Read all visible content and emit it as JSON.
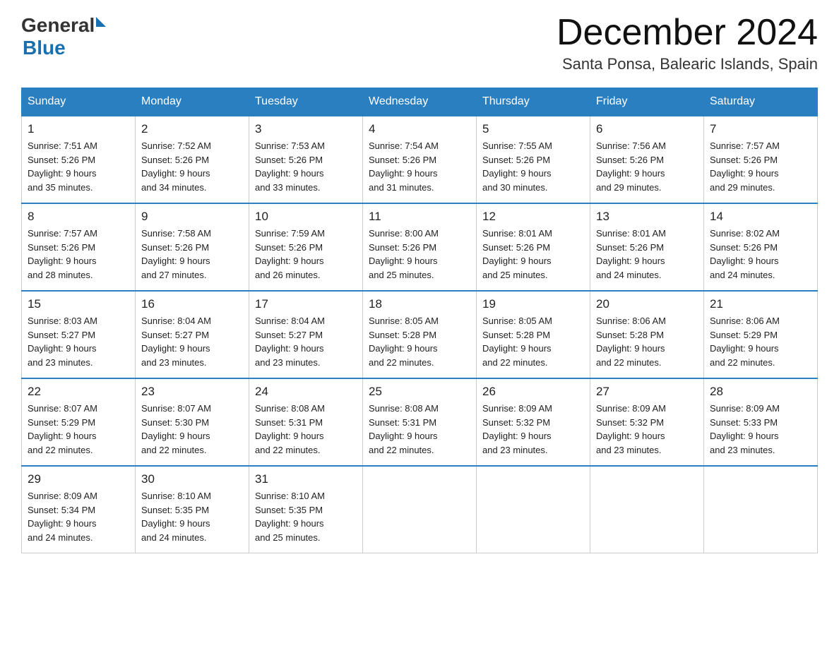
{
  "header": {
    "logo": {
      "general": "General",
      "blue": "Blue",
      "triangle": "▶"
    },
    "month_title": "December 2024",
    "location": "Santa Ponsa, Balearic Islands, Spain"
  },
  "calendar": {
    "days_of_week": [
      "Sunday",
      "Monday",
      "Tuesday",
      "Wednesday",
      "Thursday",
      "Friday",
      "Saturday"
    ],
    "weeks": [
      [
        {
          "day": "1",
          "sunrise": "7:51 AM",
          "sunset": "5:26 PM",
          "daylight": "9 hours and 35 minutes."
        },
        {
          "day": "2",
          "sunrise": "7:52 AM",
          "sunset": "5:26 PM",
          "daylight": "9 hours and 34 minutes."
        },
        {
          "day": "3",
          "sunrise": "7:53 AM",
          "sunset": "5:26 PM",
          "daylight": "9 hours and 33 minutes."
        },
        {
          "day": "4",
          "sunrise": "7:54 AM",
          "sunset": "5:26 PM",
          "daylight": "9 hours and 31 minutes."
        },
        {
          "day": "5",
          "sunrise": "7:55 AM",
          "sunset": "5:26 PM",
          "daylight": "9 hours and 30 minutes."
        },
        {
          "day": "6",
          "sunrise": "7:56 AM",
          "sunset": "5:26 PM",
          "daylight": "9 hours and 29 minutes."
        },
        {
          "day": "7",
          "sunrise": "7:57 AM",
          "sunset": "5:26 PM",
          "daylight": "9 hours and 29 minutes."
        }
      ],
      [
        {
          "day": "8",
          "sunrise": "7:57 AM",
          "sunset": "5:26 PM",
          "daylight": "9 hours and 28 minutes."
        },
        {
          "day": "9",
          "sunrise": "7:58 AM",
          "sunset": "5:26 PM",
          "daylight": "9 hours and 27 minutes."
        },
        {
          "day": "10",
          "sunrise": "7:59 AM",
          "sunset": "5:26 PM",
          "daylight": "9 hours and 26 minutes."
        },
        {
          "day": "11",
          "sunrise": "8:00 AM",
          "sunset": "5:26 PM",
          "daylight": "9 hours and 25 minutes."
        },
        {
          "day": "12",
          "sunrise": "8:01 AM",
          "sunset": "5:26 PM",
          "daylight": "9 hours and 25 minutes."
        },
        {
          "day": "13",
          "sunrise": "8:01 AM",
          "sunset": "5:26 PM",
          "daylight": "9 hours and 24 minutes."
        },
        {
          "day": "14",
          "sunrise": "8:02 AM",
          "sunset": "5:26 PM",
          "daylight": "9 hours and 24 minutes."
        }
      ],
      [
        {
          "day": "15",
          "sunrise": "8:03 AM",
          "sunset": "5:27 PM",
          "daylight": "9 hours and 23 minutes."
        },
        {
          "day": "16",
          "sunrise": "8:04 AM",
          "sunset": "5:27 PM",
          "daylight": "9 hours and 23 minutes."
        },
        {
          "day": "17",
          "sunrise": "8:04 AM",
          "sunset": "5:27 PM",
          "daylight": "9 hours and 23 minutes."
        },
        {
          "day": "18",
          "sunrise": "8:05 AM",
          "sunset": "5:28 PM",
          "daylight": "9 hours and 22 minutes."
        },
        {
          "day": "19",
          "sunrise": "8:05 AM",
          "sunset": "5:28 PM",
          "daylight": "9 hours and 22 minutes."
        },
        {
          "day": "20",
          "sunrise": "8:06 AM",
          "sunset": "5:28 PM",
          "daylight": "9 hours and 22 minutes."
        },
        {
          "day": "21",
          "sunrise": "8:06 AM",
          "sunset": "5:29 PM",
          "daylight": "9 hours and 22 minutes."
        }
      ],
      [
        {
          "day": "22",
          "sunrise": "8:07 AM",
          "sunset": "5:29 PM",
          "daylight": "9 hours and 22 minutes."
        },
        {
          "day": "23",
          "sunrise": "8:07 AM",
          "sunset": "5:30 PM",
          "daylight": "9 hours and 22 minutes."
        },
        {
          "day": "24",
          "sunrise": "8:08 AM",
          "sunset": "5:31 PM",
          "daylight": "9 hours and 22 minutes."
        },
        {
          "day": "25",
          "sunrise": "8:08 AM",
          "sunset": "5:31 PM",
          "daylight": "9 hours and 22 minutes."
        },
        {
          "day": "26",
          "sunrise": "8:09 AM",
          "sunset": "5:32 PM",
          "daylight": "9 hours and 23 minutes."
        },
        {
          "day": "27",
          "sunrise": "8:09 AM",
          "sunset": "5:32 PM",
          "daylight": "9 hours and 23 minutes."
        },
        {
          "day": "28",
          "sunrise": "8:09 AM",
          "sunset": "5:33 PM",
          "daylight": "9 hours and 23 minutes."
        }
      ],
      [
        {
          "day": "29",
          "sunrise": "8:09 AM",
          "sunset": "5:34 PM",
          "daylight": "9 hours and 24 minutes."
        },
        {
          "day": "30",
          "sunrise": "8:10 AM",
          "sunset": "5:35 PM",
          "daylight": "9 hours and 24 minutes."
        },
        {
          "day": "31",
          "sunrise": "8:10 AM",
          "sunset": "5:35 PM",
          "daylight": "9 hours and 25 minutes."
        },
        null,
        null,
        null,
        null
      ]
    ],
    "labels": {
      "sunrise": "Sunrise: ",
      "sunset": "Sunset: ",
      "daylight": "Daylight: "
    }
  }
}
